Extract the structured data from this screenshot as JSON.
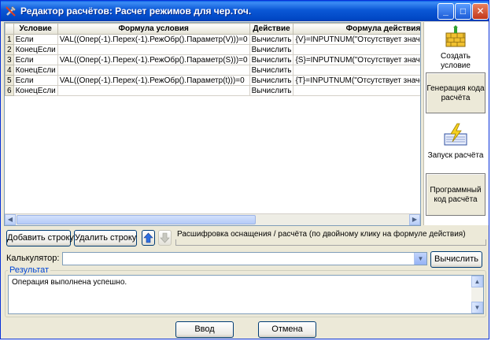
{
  "window": {
    "title": "Редактор расчётов: Расчет режимов для чер.точ."
  },
  "grid": {
    "columns": [
      "Условие",
      "Формула условия",
      "Действие",
      "Формула действия"
    ],
    "rows": [
      {
        "num": "1",
        "condition": "Если",
        "formula": "VAL((Опер(-1).Перех(-1).РежОбр().Параметр(V)))=0",
        "action": "Вычислить",
        "action_formula": "{V}=INPUTNUM(\"Отсутствует значение V\",\"Введ"
      },
      {
        "num": "2",
        "condition": "КонецЕсли",
        "formula": "",
        "action": "Вычислить",
        "action_formula": ""
      },
      {
        "num": "3",
        "condition": "Если",
        "formula": "VAL((Опер(-1).Перех(-1).РежОбр().Параметр(S)))=0",
        "action": "Вычислить",
        "action_formula": "{S}=INPUTNUM(\"Отсутствует значение S\",\"Введ"
      },
      {
        "num": "4",
        "condition": "КонецЕсли",
        "formula": "",
        "action": "Вычислить",
        "action_formula": ""
      },
      {
        "num": "5",
        "condition": "Если",
        "formula": "VAL((Опер(-1).Перех(-1).РежОбр().Параметр(t)))=0",
        "action": "Вычислить",
        "action_formula": "{T}=INPUTNUM(\"Отсутствует значение T\",\"Введ"
      },
      {
        "num": "6",
        "condition": "КонецЕсли",
        "formula": "",
        "action": "Вычислить",
        "action_formula": ""
      }
    ]
  },
  "sidebar": {
    "create_condition": "Создать условие",
    "generate_code": "Генерация кода расчёта",
    "run_calc": "Запуск расчёта",
    "program_code": "Программный код расчёта"
  },
  "toolbar": {
    "add_row": "Добавить строку",
    "delete_row": "Удалить строку",
    "decode_label": "Расшифровка оснащения / расчёта (по двойному клику на формуле действия)"
  },
  "calculator": {
    "label": "Калькулятор:",
    "value": "",
    "compute": "Вычислить"
  },
  "result": {
    "legend": "Результат",
    "text": "Операция выполнена успешно."
  },
  "footer": {
    "ok": "Ввод",
    "cancel": "Отмена"
  }
}
